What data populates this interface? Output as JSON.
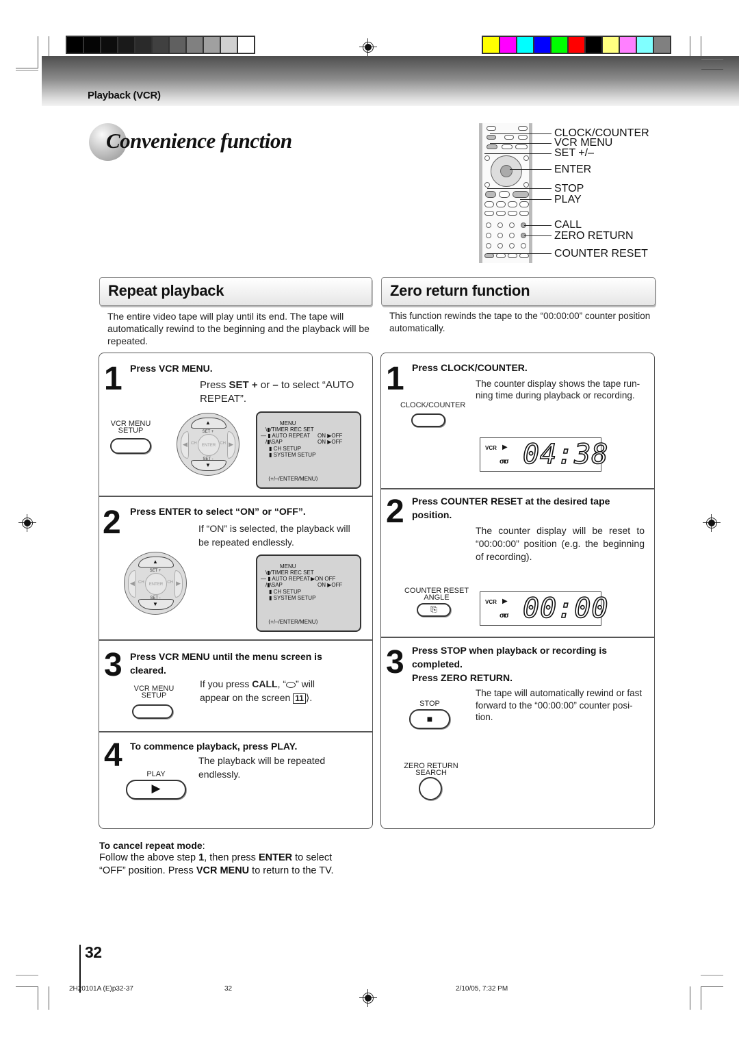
{
  "header": {
    "section_label": "Playback (VCR)",
    "page_title": "Convenience function",
    "grayscale_swatches": [
      "#000000",
      "#050505",
      "#0d0d0d",
      "#1a1a1a",
      "#2a2a2a",
      "#404040",
      "#606060",
      "#808080",
      "#a0a0a0",
      "#d0d0d0",
      "#ffffff"
    ],
    "color_swatches": [
      "#ffff00",
      "#ff00ff",
      "#00ffff",
      "#0000ff",
      "#00ff00",
      "#ff0000",
      "#000000",
      "#ffff80",
      "#ff80ff",
      "#80ffff",
      "#808080"
    ]
  },
  "remote_callouts": [
    "CLOCK/COUNTER",
    "VCR MENU",
    "SET +/–",
    "ENTER",
    "STOP",
    "PLAY",
    "CALL",
    "ZERO RETURN",
    "COUNTER RESET"
  ],
  "repeat": {
    "heading": "Repeat playback",
    "intro": "The entire video tape will play until its end. The tape will automatically rewind to the beginning and the playback will be repeated.",
    "steps": [
      {
        "num": "1",
        "title": "Press VCR MENU.",
        "text_pre": "Press ",
        "text_bold": "SET +",
        "text_mid": " or ",
        "text_bold2": "–",
        "text_post": " to select “AUTO REPEAT”.",
        "button_label_1": "VCR MENU",
        "button_label_2": "SETUP"
      },
      {
        "num": "2",
        "title": "Press ENTER to select “ON” or “OFF”.",
        "text": "If “ON” is selected, the playback will be repeated endlessly."
      },
      {
        "num": "3",
        "title": "Press VCR MENU until the menu screen is cleared.",
        "text_pre": "If you press ",
        "text_bold": "CALL",
        "text_mid": ", “",
        "text_post": "” will appear on the screen",
        "page_ref": "11",
        "button_label_1": "VCR MENU",
        "button_label_2": "SETUP"
      },
      {
        "num": "4",
        "title": "To commence playback, press PLAY.",
        "text": "The playback will be repeated endlessly.",
        "button_label": "PLAY"
      }
    ],
    "dpad": {
      "set_plus": "SET +",
      "set_minus": "SET -",
      "enter": "ENTER",
      "ch": "CH"
    },
    "osd_step1": {
      "title": "MENU",
      "items": [
        "TIMER REC SET",
        "AUTO REPEAT",
        "SAP",
        "CH SETUP",
        "SYSTEM SETUP"
      ],
      "auto_repeat_value": "ON ▶OFF",
      "sap_value": "ON ▶OFF",
      "footer": "⟨+/–/ENTER/MENU⟩"
    },
    "osd_step2": {
      "title": "MENU",
      "items": [
        "TIMER REC SET",
        "AUTO REPEAT",
        "SAP",
        "CH SETUP",
        "SYSTEM SETUP"
      ],
      "auto_repeat_value": "▶ON   OFF",
      "sap_value": "ON ▶OFF",
      "footer": "⟨+/–/ENTER/MENU⟩"
    },
    "cancel": {
      "heading": "To cancel repeat mode",
      "line1_pre": "Follow the above step ",
      "line1_bold": "1",
      "line1_mid": ", then press ",
      "line1_bold2": "ENTER",
      "line1_post": " to select",
      "line2_pre": "“OFF” position. Press ",
      "line2_bold": "VCR MENU",
      "line2_post": " to return to the TV."
    }
  },
  "zero": {
    "heading": "Zero return function",
    "intro": "This function rewinds the tape to the “00:00:00” counter position automatically.",
    "steps": [
      {
        "num": "1",
        "title": "Press CLOCK/COUNTER.",
        "text": "The counter display shows the tape run-ning time during playback or recording.",
        "button_label": "CLOCK/COUNTER",
        "display": "04:38"
      },
      {
        "num": "2",
        "title": "Press COUNTER RESET at the desired tape position.",
        "text": "The counter display will be reset to “00:00:00” position (e.g. the beginning of recording).",
        "button_label_1": "COUNTER RESET",
        "button_label_2": "ANGLE",
        "display": "00:00"
      },
      {
        "num": "3",
        "title": "Press STOP when playback or recording is completed.",
        "title2": "Press ZERO RETURN.",
        "text": "The tape will automatically rewind or fast forward to the “00:00:00” counter posi-tion.",
        "stop_label": "STOP",
        "zero_label_1": "ZERO RETURN",
        "zero_label_2": "SEARCH"
      }
    ],
    "lcd_vcr": "VCR",
    "lcd_play": "▶",
    "lcd_tape": "στσ"
  },
  "footer": {
    "page_number": "32",
    "file": "2H20101A (E)p32-37",
    "page": "32",
    "date": "2/10/05, 7:32 PM"
  }
}
